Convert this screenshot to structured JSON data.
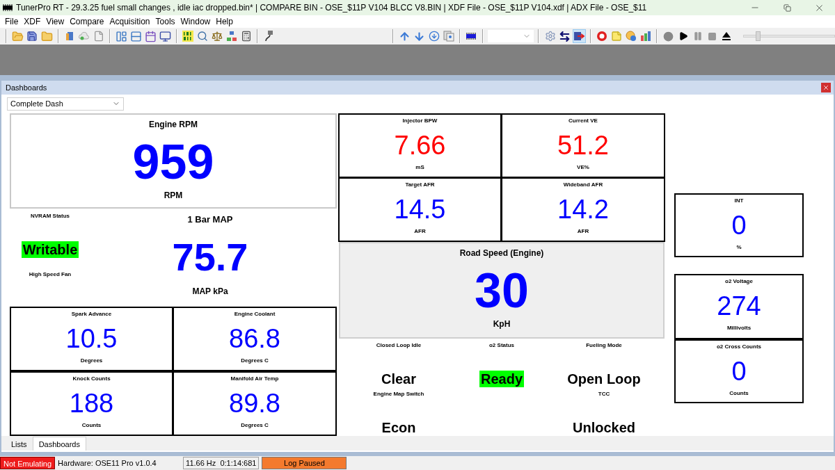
{
  "window": {
    "title": "TunerPro RT - 29.3.25  fuel small changes , idle iac dropped.bin* | COMPARE BIN - OSE_$11P V104 BLCC V8.BIN | XDF File - OSE_$11P V104.xdf | ADX File - OSE_$11"
  },
  "menu": [
    "File",
    "XDF",
    "View",
    "Compare",
    "Acquisition",
    "Tools",
    "Window",
    "Help"
  ],
  "toolbar": {
    "playback_slider": {
      "level": 0.14
    }
  },
  "dashboard_panel": {
    "title": "Dashboards",
    "selector": "Complete Dash",
    "gauges": [
      {
        "kind": "large",
        "title": "Engine RPM",
        "value": "959",
        "unit": "RPM",
        "color": "#0000ff"
      },
      {
        "kind": "status",
        "title": "NVRAM Status",
        "value": "Writable",
        "highlighted": true
      },
      {
        "kind": "plain",
        "title": "1 Bar MAP",
        "value": "75.7",
        "unit": "MAP kPa",
        "color": "#0000ff"
      },
      {
        "kind": "status",
        "title": "High Speed Fan",
        "highlighted": false
      },
      {
        "kind": "small",
        "title": "Spark Advance",
        "value": "10.5",
        "unit": "Degrees",
        "color": "#0000ff"
      },
      {
        "kind": "small",
        "title": "Engine Coolant",
        "value": "86.8",
        "unit": "Degrees C",
        "color": "#0000ff"
      },
      {
        "kind": "small",
        "title": "Knock Counts",
        "value": "188",
        "unit": "Counts",
        "color": "#0000ff"
      },
      {
        "kind": "small",
        "title": "Manifold Air Temp",
        "value": "89.8",
        "unit": "Degrees C",
        "color": "#0000ff"
      },
      {
        "kind": "small",
        "title": "Injector BPW",
        "value": "7.66",
        "unit": "mS",
        "color": "#ff0000"
      },
      {
        "kind": "small",
        "title": "Current VE",
        "value": "51.2",
        "unit": "VE%",
        "color": "#ff0000"
      },
      {
        "kind": "small",
        "title": "Target AFR",
        "value": "14.5",
        "unit": "AFR",
        "color": "#0000ff"
      },
      {
        "kind": "small",
        "title": "Wideband AFR",
        "value": "14.2",
        "unit": "AFR",
        "color": "#0000ff"
      },
      {
        "kind": "shaded",
        "title": "Road Speed (Engine)",
        "value": "30",
        "unit": "KpH",
        "color": "#0000ff"
      },
      {
        "kind": "status",
        "title": "Closed Loop Idle",
        "value": "Clear",
        "highlighted": false
      },
      {
        "kind": "status",
        "title": "o2 Status",
        "value": "Ready",
        "highlighted": true
      },
      {
        "kind": "status",
        "title": "Fueling Mode",
        "value": "Open Loop",
        "highlighted": false
      },
      {
        "kind": "status",
        "title": "Engine Map Switch",
        "value": "Econ",
        "highlighted": false
      },
      {
        "kind": "status",
        "title": "TCC",
        "value": "Unlocked",
        "highlighted": false
      },
      {
        "kind": "small",
        "title": "INT",
        "value": "0",
        "unit": "%",
        "color": "#0000ff"
      },
      {
        "kind": "small",
        "title": "o2 Voltage",
        "value": "274",
        "unit": "Millivolts",
        "color": "#0000ff"
      },
      {
        "kind": "small",
        "title": "o2 Cross Counts",
        "value": "0",
        "unit": "Counts",
        "color": "#0000ff"
      }
    ]
  },
  "bottom_tabs": [
    {
      "label": "Lists",
      "selected": false
    },
    {
      "label": "Dashboards",
      "selected": true
    }
  ],
  "status_bar": {
    "emulation": "Not Emulating",
    "hardware": "Hardware: OSE11 Pro v1.0.4",
    "rate": "11.66 Hz  0:1:14:681",
    "log": "Log Paused"
  }
}
